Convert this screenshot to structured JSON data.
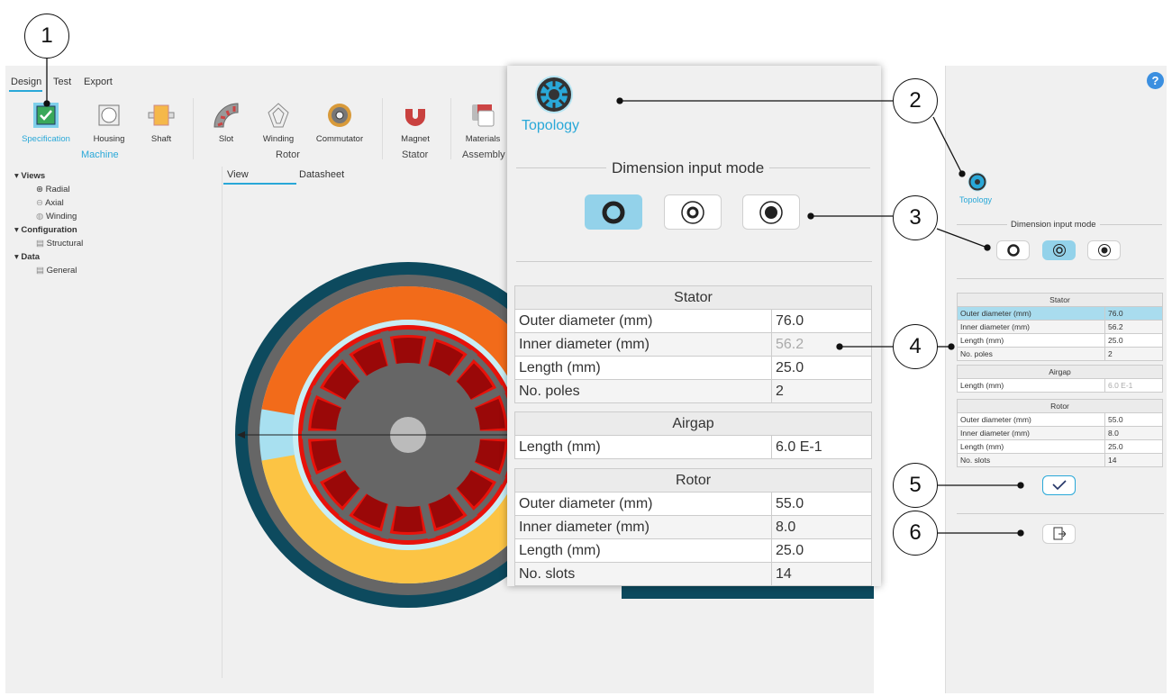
{
  "menu": {
    "tabs": [
      "Design",
      "Test",
      "Export"
    ]
  },
  "toolbar": {
    "items": [
      "Specification",
      "Housing",
      "Shaft",
      "Slot",
      "Winding",
      "Commutator",
      "Magnet",
      "Materials"
    ],
    "groups": [
      "Machine",
      "Rotor",
      "Stator",
      "Assembly"
    ]
  },
  "tree": {
    "views": "Views",
    "radial": "Radial",
    "axial": "Axial",
    "winding": "Winding",
    "configuration": "Configuration",
    "structural": "Structural",
    "data": "Data",
    "general": "General"
  },
  "view_tabs": [
    "View",
    "Datasheet"
  ],
  "popup": {
    "topology": "Topology",
    "mode_title": "Dimension input mode"
  },
  "panel": {
    "topology": "Topology",
    "mode_title": "Dimension input mode",
    "help": "?"
  },
  "tables": [
    {
      "title": "Stator",
      "rows": [
        [
          "Outer diameter (mm)",
          "76.0"
        ],
        [
          "Inner diameter (mm)",
          "56.2"
        ],
        [
          "Length (mm)",
          "25.0"
        ],
        [
          "No. poles",
          "2"
        ]
      ]
    },
    {
      "title": "Airgap",
      "rows": [
        [
          "Length (mm)",
          "6.0 E-1"
        ]
      ]
    },
    {
      "title": "Rotor",
      "rows": [
        [
          "Outer diameter (mm)",
          "55.0"
        ],
        [
          "Inner diameter (mm)",
          "8.0"
        ],
        [
          "Length (mm)",
          "25.0"
        ],
        [
          "No. slots",
          "14"
        ]
      ]
    }
  ],
  "callouts": [
    "1",
    "2",
    "3",
    "4",
    "5",
    "6"
  ],
  "colors": {
    "accent": "#29a8d8",
    "frame": "#0d4a5e",
    "orange": "#f26b1a",
    "yellow": "#fcc444",
    "rotor": "#e8120a"
  }
}
